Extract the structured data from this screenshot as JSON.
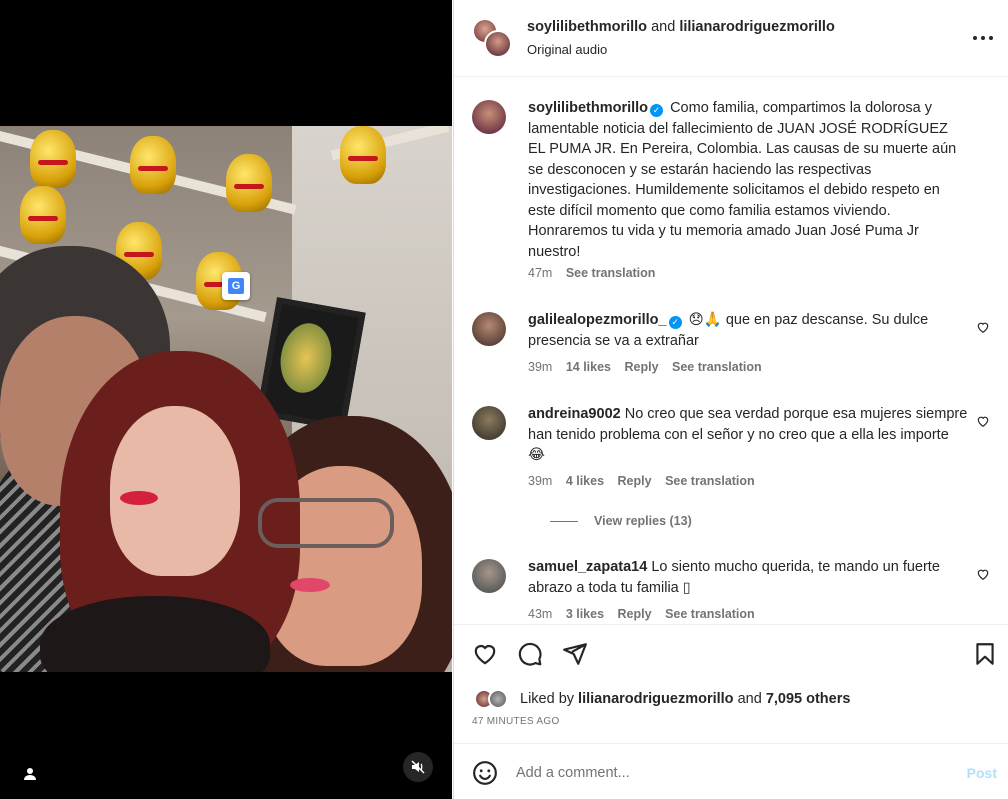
{
  "header": {
    "user1": "soylilibethmorillo",
    "and": "and",
    "user2": "lilianarodriguezmorillo",
    "audio": "Original audio"
  },
  "caption": {
    "user": "soylilibethmorillo",
    "text": "Como familia, compartimos la dolorosa y lamentable noticia del fallecimiento de JUAN JOSÉ RODRÍGUEZ EL PUMA JR. En Pereira, Colombia. Las causas de su muerte aún se desconocen y se estarán haciendo las respectivas investigaciones. Humildemente solicitamos el debido respeto en este difícil momento que como familia estamos viviendo. Honraremos tu vida y tu memoria amado Juan José Puma Jr nuestro!",
    "time": "47m",
    "see_translation": "See translation"
  },
  "comments": [
    {
      "user": "galilealopezmorillo_",
      "text": "😞🙏 que en paz descanse. Su dulce presencia se va a extrañar",
      "time": "39m",
      "likes": "14 likes",
      "reply": "Reply",
      "see_translation": "See translation"
    },
    {
      "user": "andreina9002",
      "text": "No creo que sea verdad porque esa mujeres siempre han tenido problema con el señor y no creo que a ella les importe 😂",
      "time": "39m",
      "likes": "4 likes",
      "reply": "Reply",
      "see_translation": "See translation",
      "view_replies": "View replies (13)"
    },
    {
      "user": "samuel_zapata14",
      "text": "Lo siento mucho querida, te mando un fuerte abrazo a toda tu familia ▯",
      "time": "43m",
      "likes": "3 likes",
      "reply": "Reply",
      "see_translation": "See translation"
    }
  ],
  "likes": {
    "prefix": "Liked by",
    "user": "lilianarodriguezmorillo",
    "and": "and",
    "others": "7,095 others",
    "time_ago": "47 MINUTES AGO"
  },
  "add_comment": {
    "placeholder": "Add a comment...",
    "post": "Post"
  },
  "colors": {
    "verified": "#0095f6",
    "post_disabled": "#b2dffc",
    "secondary_text": "#737373"
  },
  "icons": [
    "heart-icon",
    "comment-icon",
    "share-icon",
    "bookmark-icon",
    "emoji-icon",
    "more-icon",
    "mute-icon",
    "user-tag-icon",
    "translate-icon"
  ]
}
